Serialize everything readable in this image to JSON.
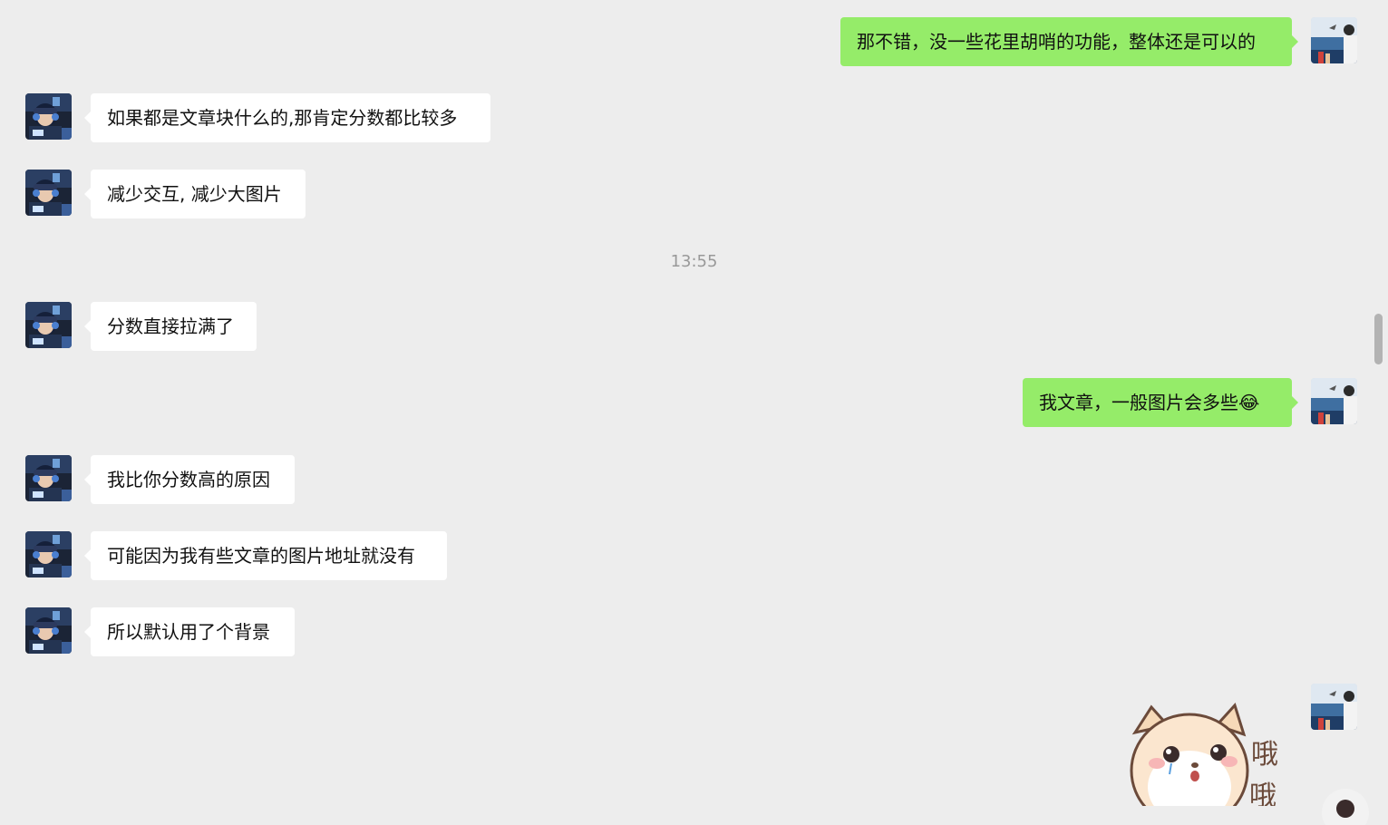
{
  "messages": [
    {
      "side": "right",
      "text": "那不错，没一些花里胡哨的功能，整体还是可以的"
    },
    {
      "side": "left",
      "text": "如果都是文章块什么的,那肯定分数都比较多"
    },
    {
      "side": "left",
      "text": "减少交互, 减少大图片"
    },
    {
      "timestamp": "13:55"
    },
    {
      "side": "left",
      "text": "分数直接拉满了"
    },
    {
      "side": "right",
      "text": "我文章，一般图片会多些",
      "emoji": "tears-of-joy"
    },
    {
      "side": "left",
      "text": "我比你分数高的原因"
    },
    {
      "side": "left",
      "text": "可能因为我有些文章的图片地址就没有"
    },
    {
      "side": "left",
      "text": "所以默认用了个背景"
    },
    {
      "side": "right",
      "sticker": "cat-sticker",
      "sticker_text": "哦哦"
    }
  ],
  "colors": {
    "background": "#ededed",
    "self_bubble": "#95ec69",
    "other_bubble": "#ffffff",
    "timestamp": "#999999"
  },
  "icons": {
    "tears_of_joy": "😂",
    "sticker_char_1": "哦",
    "sticker_char_2": "哦"
  }
}
